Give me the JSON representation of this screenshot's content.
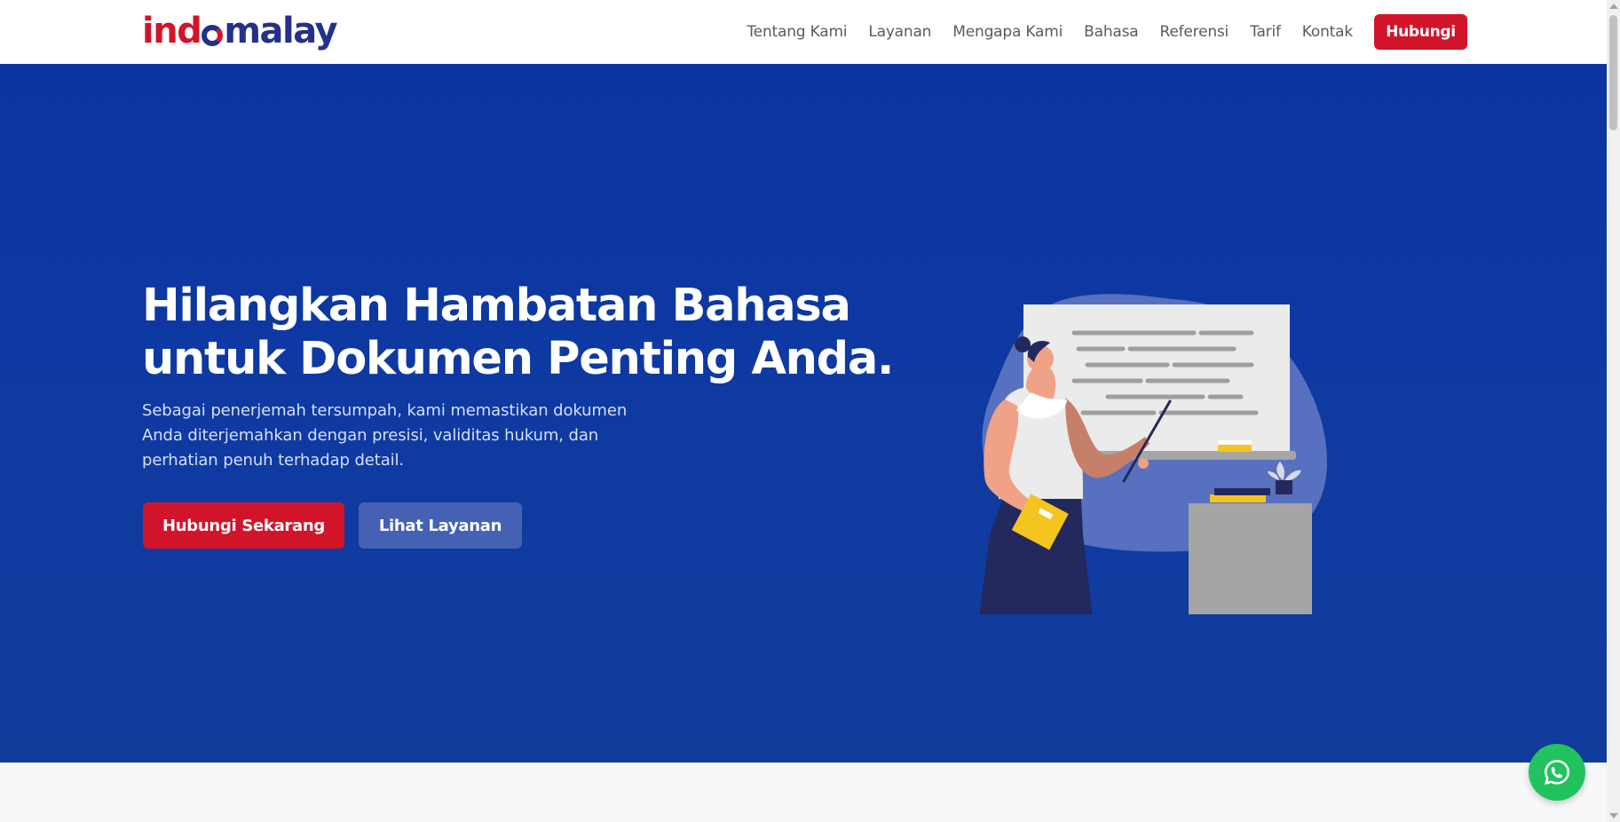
{
  "header": {
    "logo_parts": {
      "a": "ind",
      "b": "malay"
    },
    "nav": [
      "Tentang Kami",
      "Layanan",
      "Mengapa Kami",
      "Bahasa",
      "Referensi",
      "Tarif",
      "Kontak"
    ],
    "cta_label": "Hubungi"
  },
  "hero": {
    "title_line1": "Hilangkan Hambatan Bahasa",
    "title_line2": "untuk Dokumen Penting Anda.",
    "sub_line1": "Sebagai penerjemah tersumpah, kami memastikan dokumen",
    "sub_line2": "Anda diterjemahkan dengan presisi, validitas hukum, dan",
    "sub_line3": "perhatian penuh terhadap detail.",
    "primary_button": "Hubungi Sekarang",
    "secondary_button": "Lihat Layanan"
  },
  "floating": {
    "icon": "whatsapp-icon"
  },
  "colors": {
    "brand_blue": "#23318a",
    "brand_red": "#d2142a",
    "hero_bg": "#0e3aa2",
    "secondary_button": "#4561b3",
    "whatsapp": "#22c35e"
  }
}
